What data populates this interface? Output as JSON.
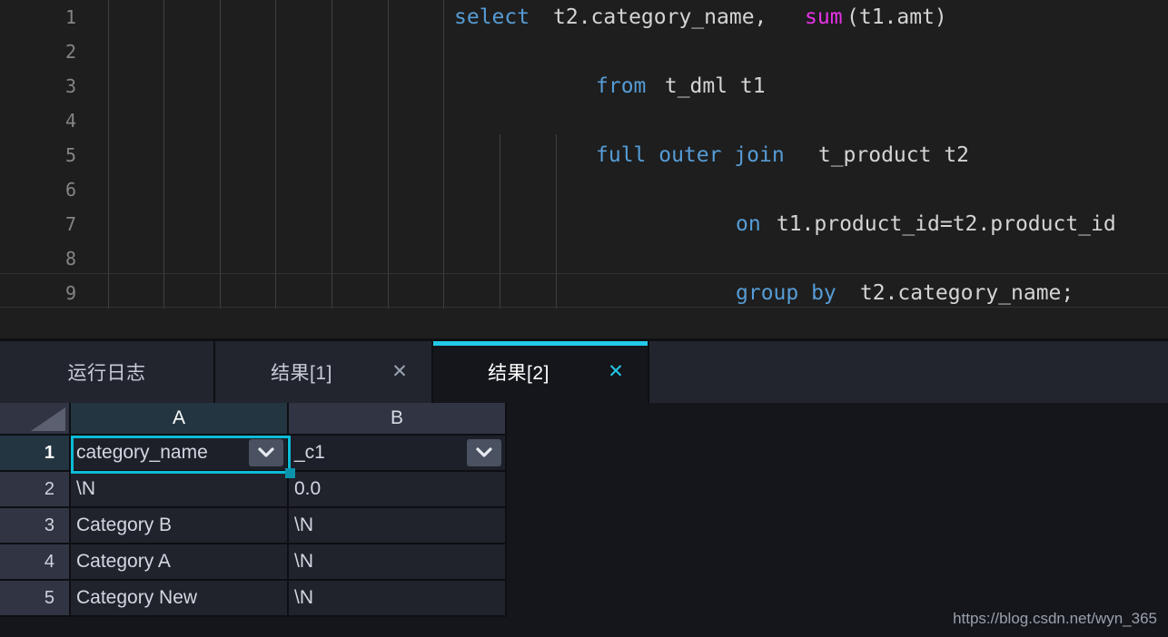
{
  "editor": {
    "line_numbers": [
      "1",
      "2",
      "3",
      "4",
      "5",
      "6",
      "7",
      "8",
      "9"
    ],
    "lines": [
      {
        "n": 1,
        "tokens": [
          {
            "t": "select",
            "c": "kw"
          },
          {
            "t": " ",
            "c": "op"
          },
          {
            "t": "t2.category_name, ",
            "c": "id"
          },
          {
            "t": "sum",
            "c": "fn"
          },
          {
            "t": "(t1.amt)",
            "c": "id"
          }
        ]
      },
      {
        "n": 2,
        "tokens": []
      },
      {
        "n": 3,
        "tokens": [
          {
            "t": "from",
            "c": "kw"
          },
          {
            "t": " t_dml t1",
            "c": "id"
          }
        ]
      },
      {
        "n": 4,
        "tokens": []
      },
      {
        "n": 5,
        "tokens": [
          {
            "t": "full outer join",
            "c": "kw"
          },
          {
            "t": " t_product t2",
            "c": "id"
          }
        ]
      },
      {
        "n": 6,
        "tokens": []
      },
      {
        "n": 7,
        "tokens": [
          {
            "t": "on",
            "c": "kw"
          },
          {
            "t": " t1.product_id=t2.product_id",
            "c": "id"
          }
        ]
      },
      {
        "n": 8,
        "tokens": []
      },
      {
        "n": 9,
        "tokens": [
          {
            "t": "group by",
            "c": "kw"
          },
          {
            "t": " t2.category_name;",
            "c": "id"
          }
        ]
      }
    ],
    "full_text": "select t2.category_name, sum(t1.amt)\n\n        from t_dml t1\n\n        full outer join t_product t2\n\n            on t1.product_id=t2.product_id\n\n            group by t2.category_name;",
    "current_line": 9
  },
  "tabs": [
    {
      "label": "运行日志",
      "closable": false,
      "active": false,
      "close_label": ""
    },
    {
      "label": "结果[1]",
      "closable": true,
      "active": false,
      "close_label": "✕"
    },
    {
      "label": "结果[2]",
      "closable": true,
      "active": true,
      "close_label": "✕"
    }
  ],
  "grid": {
    "corner_label": "",
    "columns": [
      "A",
      "B"
    ],
    "selected_column": "A",
    "selected_row": "1",
    "row_headers": [
      "1",
      "2",
      "3",
      "4",
      "5"
    ],
    "rows": [
      [
        "category_name",
        "_c1"
      ],
      [
        "\\N",
        "0.0"
      ],
      [
        "Category B",
        "\\N"
      ],
      [
        "Category A",
        "\\N"
      ],
      [
        "Category New",
        "\\N"
      ]
    ],
    "selected_cell": "A1",
    "dropdown_icon": "chevron-down-icon"
  },
  "watermark": "https://blog.csdn.net/wyn_365",
  "colors": {
    "accent_cyan": "#23c9e8",
    "selection_cyan": "#0bbcd6",
    "keyword_blue": "#569cd6",
    "function_magenta": "#e832e8",
    "identifier_gray": "#d4d4d4",
    "editor_bg": "#1e1e1e",
    "panel_bg": "#14161c",
    "tabbar_bg": "#22252e",
    "header_slate": "#313543",
    "header_selected": "#233541",
    "cell_bg": "#20232c"
  }
}
